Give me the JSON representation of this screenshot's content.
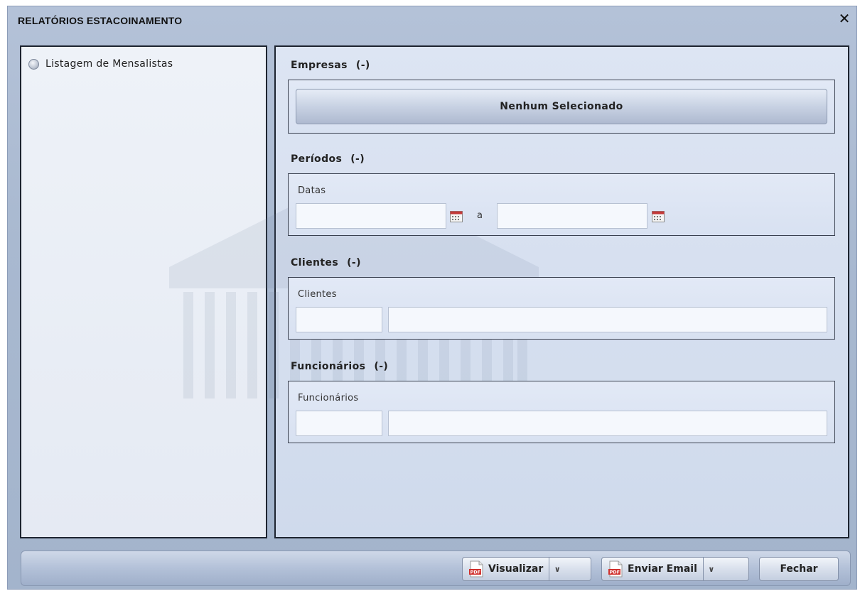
{
  "window": {
    "title": "RELATÓRIOS ESTACOINAMENTO",
    "close_glyph": "✕"
  },
  "left": {
    "items": [
      {
        "label": "Listagem de Mensalistas",
        "selected": false
      }
    ]
  },
  "sections": {
    "empresas": {
      "title": "Empresas",
      "toggle": "(-)",
      "button_label": "Nenhum Selecionado"
    },
    "periodos": {
      "title": "Períodos",
      "toggle": "(-)",
      "field_label": "Datas",
      "date_from": "",
      "date_to": "",
      "separator": "a"
    },
    "clientes": {
      "title": "Clientes",
      "toggle": "(-)",
      "field_label": "Clientes",
      "code": "",
      "name": ""
    },
    "funcionarios": {
      "title": "Funcionários",
      "toggle": "(-)",
      "field_label": "Funcionários",
      "code": "",
      "name": ""
    }
  },
  "toolbar": {
    "visualizar_label": "Visualizar",
    "enviar_email_label": "Enviar Email",
    "fechar_label": "Fechar",
    "caret_glyph": "∨"
  },
  "colors": {
    "accent": "#a9b9d0",
    "panel_border": "#1d2430",
    "pdf_red": "#d0302c"
  }
}
